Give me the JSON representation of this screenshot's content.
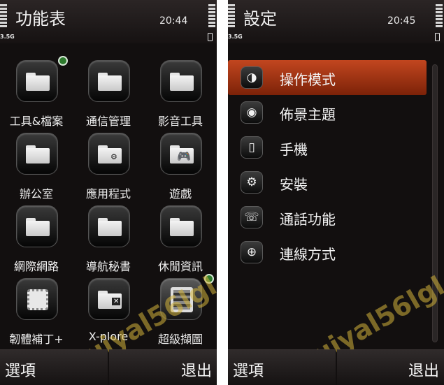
{
  "left_screen": {
    "title": "功能表",
    "time": "20:44",
    "network": "3.5G",
    "apps": [
      {
        "label": "工具&檔案",
        "icon": "folder-icon"
      },
      {
        "label": "通信管理",
        "icon": "folder-icon"
      },
      {
        "label": "影音工具",
        "icon": "folder-icon"
      },
      {
        "label": "辦公室",
        "icon": "folder-icon"
      },
      {
        "label": "應用程式",
        "icon": "folder-settings-icon"
      },
      {
        "label": "遊戲",
        "icon": "gamepad-folder-icon"
      },
      {
        "label": "網際網路",
        "icon": "folder-icon"
      },
      {
        "label": "導航秘書",
        "icon": "folder-icon"
      },
      {
        "label": "休閒資訊",
        "icon": "folder-icon"
      },
      {
        "label": "韌體補丁+",
        "icon": "chip-icon"
      },
      {
        "label": "X-plore",
        "icon": "xplore-folder-icon"
      },
      {
        "label": "超級擷圖",
        "icon": "screenshot-app-icon"
      }
    ],
    "softkeys": {
      "left": "選項",
      "right": "退出"
    }
  },
  "right_screen": {
    "title": "設定",
    "time": "20:45",
    "network": "3.5G",
    "items": [
      {
        "label": "操作模式",
        "icon": "general-settings-icon",
        "selected": true
      },
      {
        "label": "佈景主題",
        "icon": "palette-icon",
        "selected": false
      },
      {
        "label": "手機",
        "icon": "phone-icon",
        "selected": false
      },
      {
        "label": "安裝",
        "icon": "gears-icon",
        "selected": false
      },
      {
        "label": "通話功能",
        "icon": "call-icon",
        "selected": false
      },
      {
        "label": "連線方式",
        "icon": "globe-icon",
        "selected": false
      }
    ],
    "softkeys": {
      "left": "選項",
      "right": "退出"
    }
  },
  "watermark": "huiyal56lgl",
  "colors": {
    "selection": "#b53d18",
    "background": "#120f0f"
  }
}
